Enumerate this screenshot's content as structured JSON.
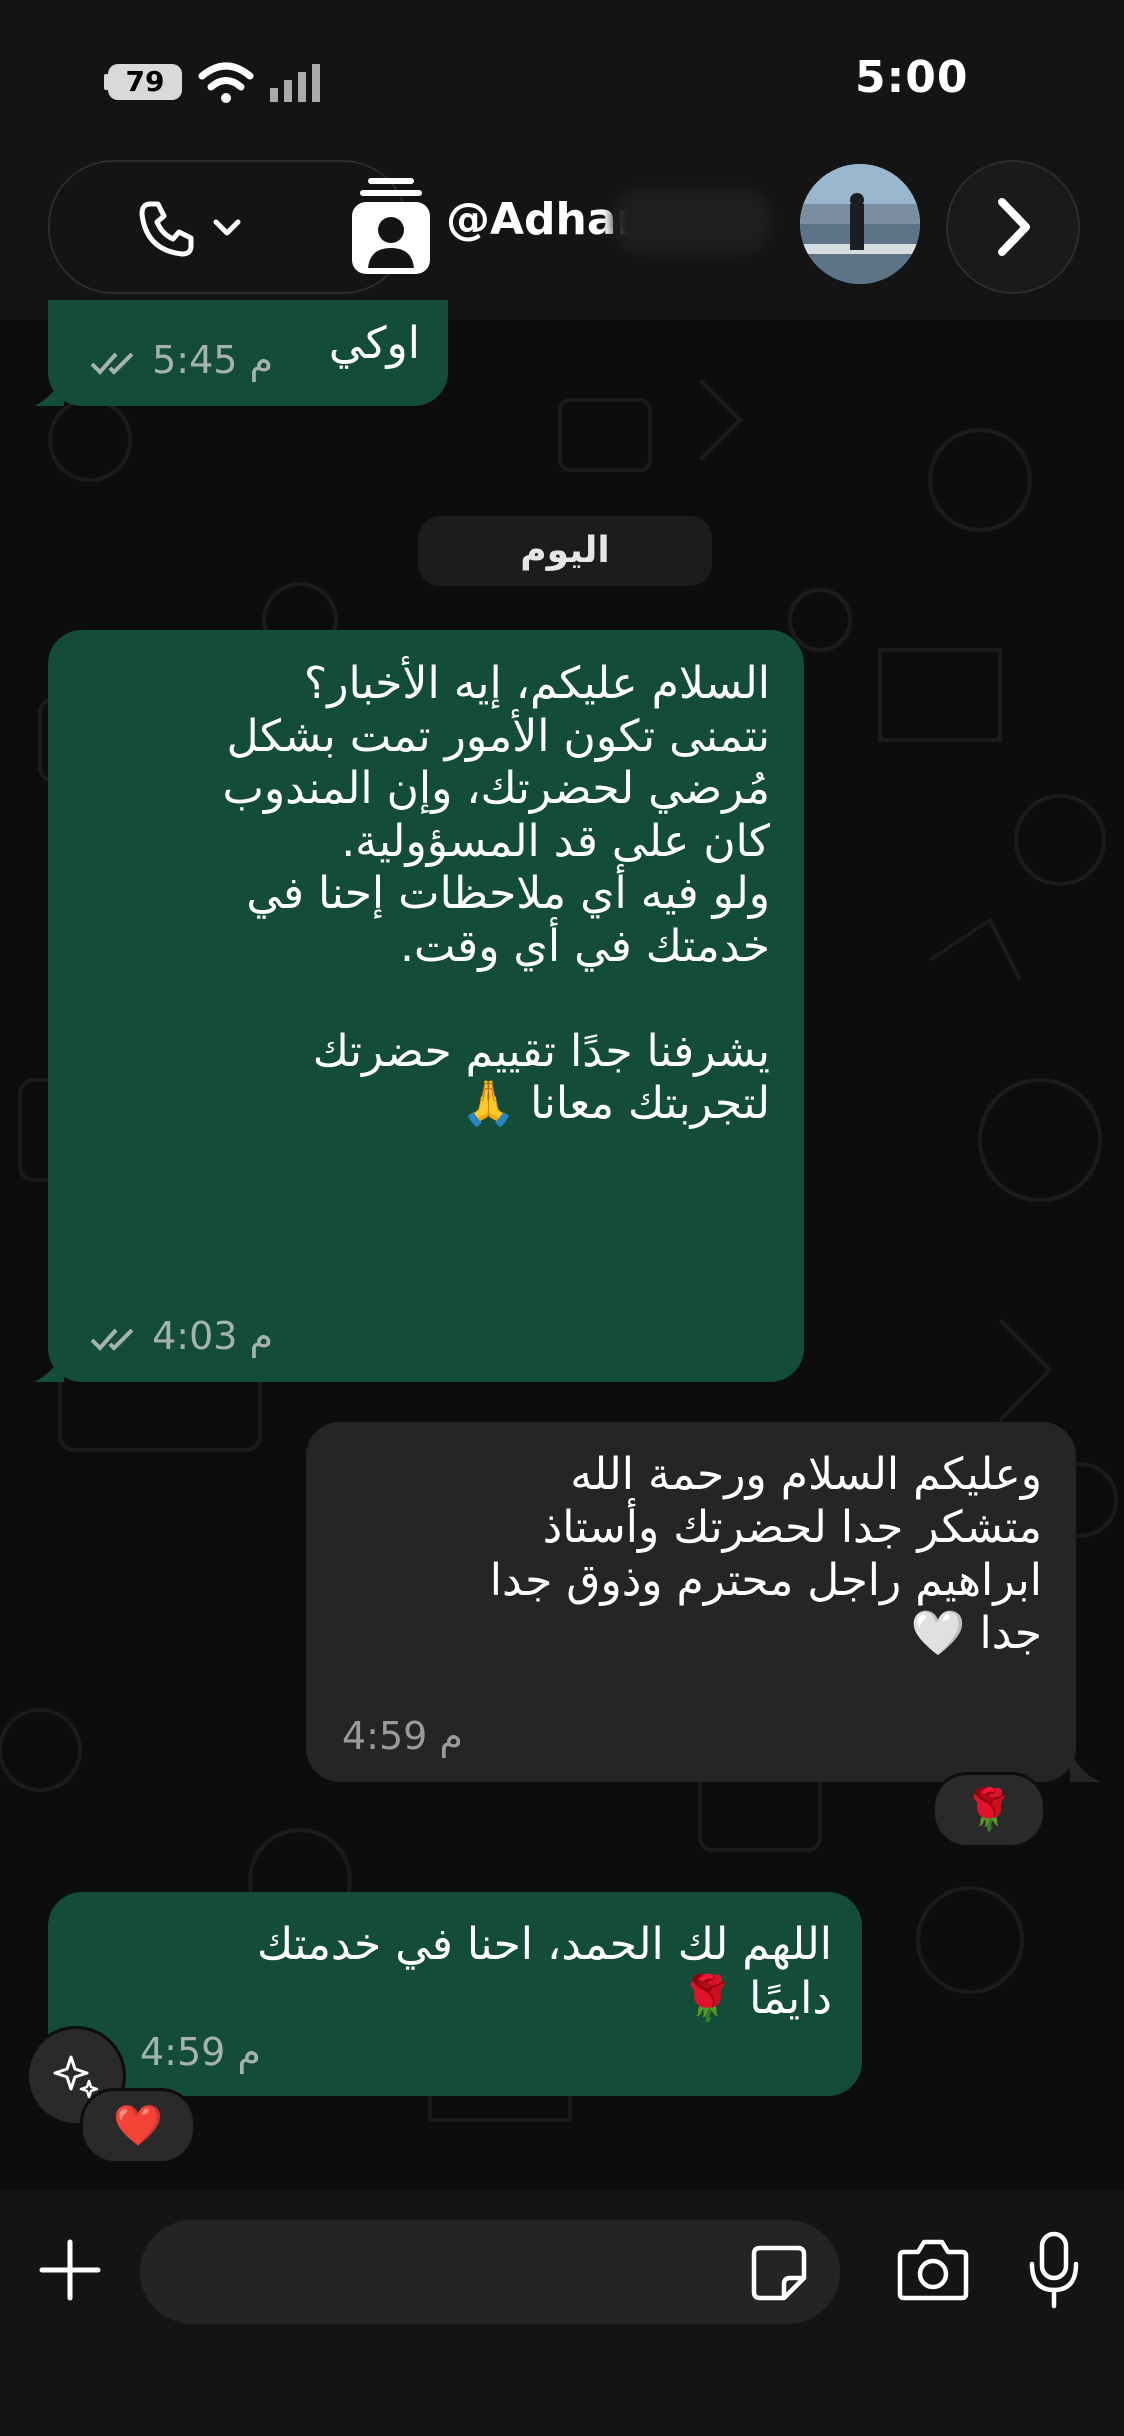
{
  "status_bar": {
    "battery": "79",
    "time": "5:00"
  },
  "header": {
    "contact_name": "@Adham",
    "call_icon": "phone-icon",
    "chevron_icon": "chevron-down-icon",
    "contact_card_icon": "contact-card-icon",
    "next_icon": "chevron-right-icon"
  },
  "chat": {
    "day_separator": "اليوم",
    "messages": [
      {
        "direction": "outgoing",
        "text": "اوكي",
        "time": "5:45 م"
      },
      {
        "direction": "outgoing",
        "text": "السلام عليكم، إيه الأخبار؟\nنتمنى تكون الأمور تمت بشكل\nمُرضي لحضرتك، وإن المندوب\nكان على قد المسؤولية.\nولو فيه أي ملاحظات إحنا في\nخدمتك في أي وقت.\n\nيشرفنا جدًا تقييم حضرتك\nلتجربتك معانا 🙏",
        "time": "4:03 م"
      },
      {
        "direction": "incoming",
        "text": "وعليكم السلام ورحمة الله\nمتشكر جدا لحضرتك وأستاذ\nابراهيم راجل محترم وذوق جدا\nجدا 🤍",
        "time": "4:59 م",
        "reaction": "🌹"
      },
      {
        "direction": "outgoing",
        "text": "اللهم لك الحمد، احنا في خدمتك\nدايمًا 🌹",
        "time": "4:59 م",
        "reaction": "❤️"
      }
    ]
  },
  "input_bar": {
    "placeholder": "",
    "icons": [
      "plus-icon",
      "sticker-icon",
      "camera-icon",
      "mic-icon"
    ]
  },
  "colors": {
    "outgoing_bubble": "#144d37",
    "incoming_bubble": "#242626",
    "background": "#0d0d0d"
  }
}
